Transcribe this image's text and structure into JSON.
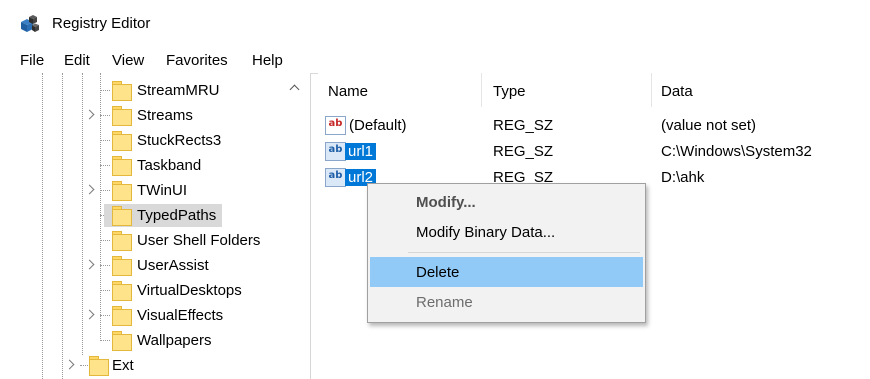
{
  "window": {
    "title": "Registry Editor",
    "icon": "registry-cubes-icon"
  },
  "menu": [
    "File",
    "Edit",
    "View",
    "Favorites",
    "Help"
  ],
  "tree": {
    "items": [
      {
        "label": "StreamMRU",
        "expandable": false
      },
      {
        "label": "Streams",
        "expandable": true
      },
      {
        "label": "StuckRects3",
        "expandable": false
      },
      {
        "label": "Taskband",
        "expandable": false
      },
      {
        "label": "TWinUI",
        "expandable": true
      },
      {
        "label": "TypedPaths",
        "expandable": false,
        "selected": true
      },
      {
        "label": "User Shell Folders",
        "expandable": false
      },
      {
        "label": "UserAssist",
        "expandable": true
      },
      {
        "label": "VirtualDesktops",
        "expandable": false
      },
      {
        "label": "VisualEffects",
        "expandable": true
      },
      {
        "label": "Wallpapers",
        "expandable": false
      }
    ],
    "parent_item": {
      "label": "Ext",
      "expandable": true
    }
  },
  "list": {
    "columns": [
      "Name",
      "Type",
      "Data"
    ],
    "rows": [
      {
        "name": "(Default)",
        "type": "REG_SZ",
        "data": "(value not set)",
        "icon": "string-value-icon"
      },
      {
        "name": "url1",
        "type": "REG_SZ",
        "data": "C:\\Windows\\System32",
        "icon": "string-value-icon",
        "selected": true
      },
      {
        "name": "url2",
        "type": "REG_SZ",
        "data": "D:\\ahk",
        "icon": "string-value-icon",
        "selected": true
      }
    ]
  },
  "context_menu": {
    "items": [
      {
        "label": "Modify...",
        "bold": true
      },
      {
        "label": "Modify Binary Data..."
      },
      {
        "label": "Delete",
        "highlighted": true
      },
      {
        "label": "Rename",
        "disabled": true
      }
    ]
  },
  "colors": {
    "selection": "#0078d7",
    "menu_highlight": "#91c9f7",
    "tree_selection": "#d9d9d9",
    "folder": "#ffe38a",
    "disabled_text": "#6d6d6d"
  }
}
